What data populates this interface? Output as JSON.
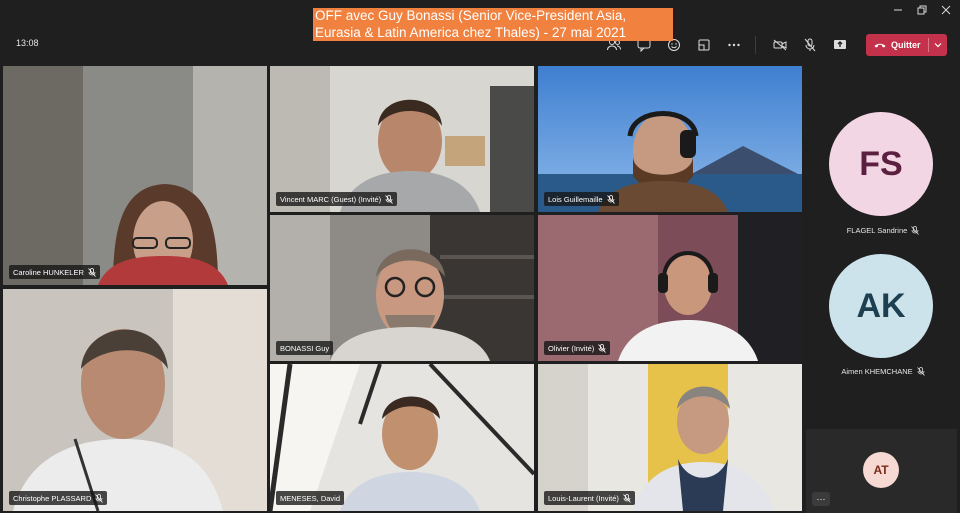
{
  "window": {
    "controls": [
      "minimize",
      "restore",
      "close"
    ]
  },
  "toolbar": {
    "time": "13:08",
    "buttons": [
      "participants-icon",
      "chat-icon",
      "reactions-icon",
      "rooms-icon",
      "more-icon",
      "camera-off-icon",
      "mic-off-icon",
      "share-icon"
    ],
    "leave_label": "Quitter",
    "leave_color": "#c4314b"
  },
  "caption": {
    "text": "OFF avec Guy Bonassi (Senior Vice-President Asia, Eurasia & Latin America chez Thales) - 27 mai 2021",
    "background": "#f0813f"
  },
  "tiles": [
    {
      "name": "Caroline HUNKELER",
      "muted": true
    },
    {
      "name": "Vincent MARC (Guest) (Invité)",
      "muted": true
    },
    {
      "name": "Lois Guillemaille",
      "muted": true
    },
    {
      "name": "BONASSI Guy",
      "muted": false,
      "active": true
    },
    {
      "name": "Olivier (Invité)",
      "muted": true
    },
    {
      "name": "Christophe PLASSARD",
      "muted": true
    },
    {
      "name": "MENESES, David",
      "muted": false
    },
    {
      "name": "Louis-Laurent (Invité)",
      "muted": true
    }
  ],
  "roster": [
    {
      "initials": "FS",
      "name": "FLAGEL Sandrine",
      "muted": true,
      "bg": "#f3d6e4",
      "fg": "#5b1f3f"
    },
    {
      "initials": "AK",
      "name": "Aimen KHEMCHANE",
      "muted": true,
      "bg": "#cde3ec",
      "fg": "#1d3f4f"
    }
  ],
  "self": {
    "initials": "AT",
    "bg": "#f6d9d2",
    "fg": "#7a2a1a",
    "more_label": "···"
  }
}
